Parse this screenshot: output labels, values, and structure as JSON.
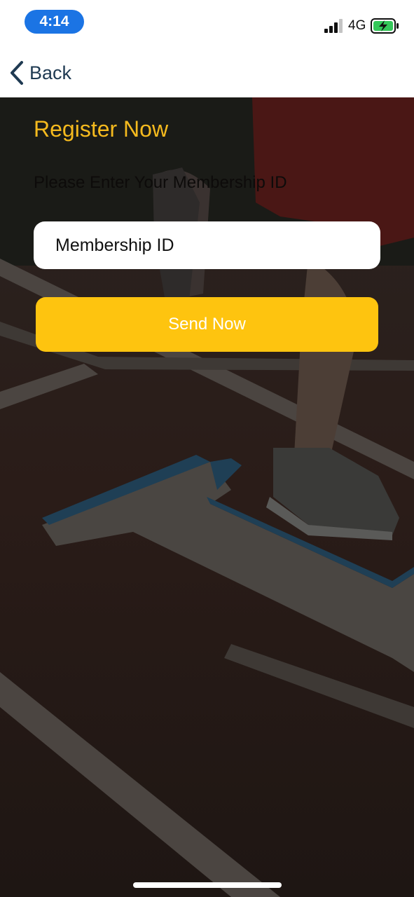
{
  "status_bar": {
    "time": "4:14",
    "network": "4G",
    "signal_icon": "cellular-signal-icon",
    "battery_icon": "battery-charging-icon",
    "time_pill_color": "#1b74e4",
    "battery_color": "#34c759"
  },
  "nav": {
    "back_label": "Back",
    "back_icon": "chevron-left-icon"
  },
  "form": {
    "title": "Register Now",
    "instruction": "Please Enter Your Membership ID",
    "membership_placeholder": "Membership ID",
    "membership_value": "",
    "send_label": "Send Now"
  },
  "colors": {
    "accent": "#f5ba1e",
    "button": "#fec40f",
    "nav_text": "#1f3a52"
  }
}
